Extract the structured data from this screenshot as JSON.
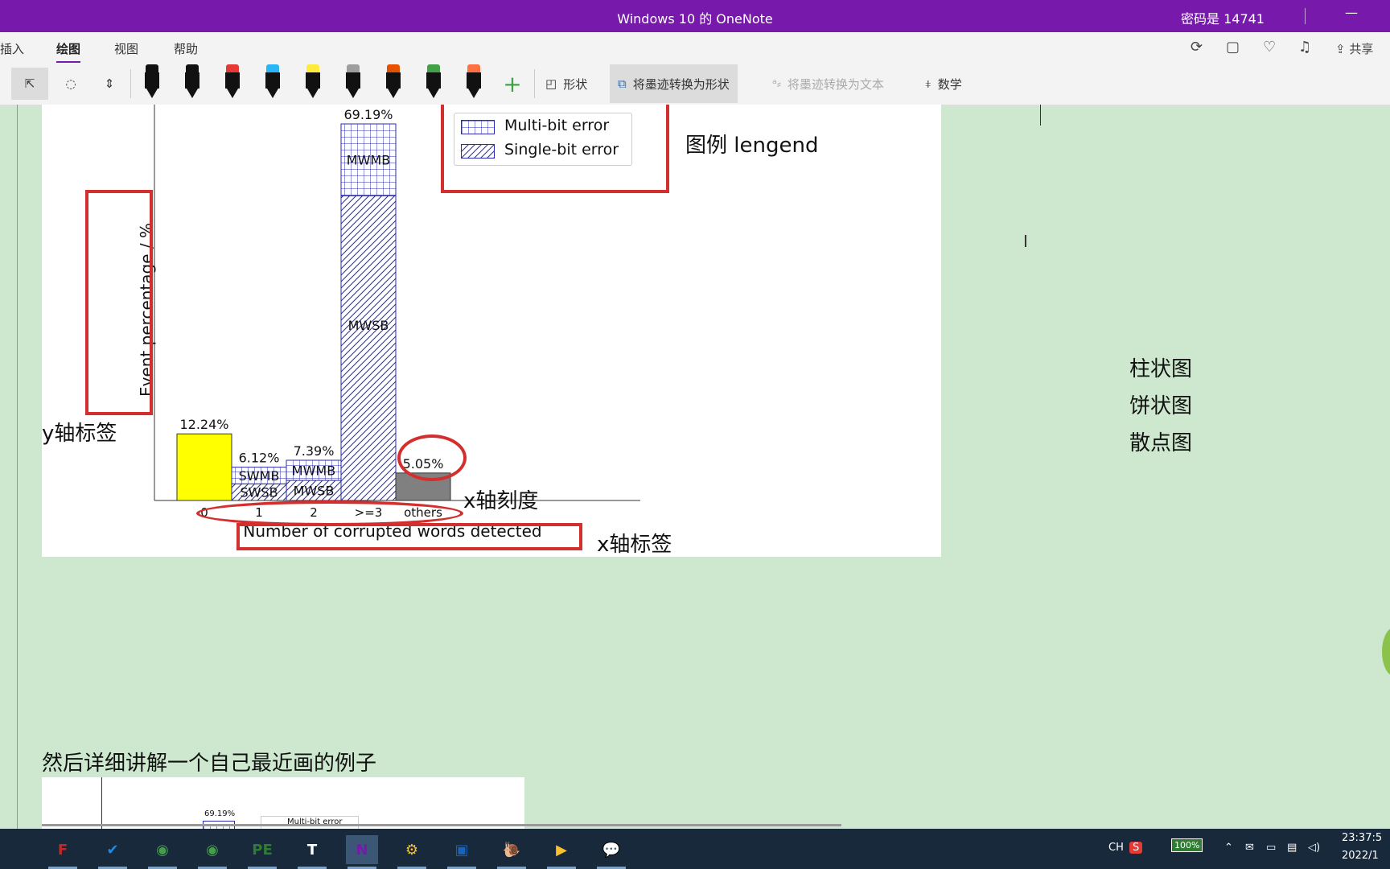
{
  "titlebar": {
    "title": "Windows 10 的 OneNote",
    "password": "密码是 14741",
    "minimize": "—"
  },
  "menu": {
    "insert": "插入",
    "draw": "绘图",
    "view": "视图",
    "help": "帮助",
    "share": "共享"
  },
  "ribbon": {
    "pen_colors": [
      "#111111",
      "#111111",
      "#e53935",
      "#29b6f6",
      "#ffeb3b",
      "#9e9e9e",
      "#e65100",
      "#43a047",
      "#ff7043"
    ],
    "shapes": "形状",
    "ink_to_shape": "将墨迹转换为形状",
    "ink_to_text": "将墨迹转换为文本",
    "math": "数学",
    "plus": "+"
  },
  "notes": {
    "legend_label": "图例 lengend",
    "y_label": "y轴标签",
    "x_ticks": "x轴刻度",
    "x_label": "x轴标签",
    "types": [
      "柱状图",
      "饼状图",
      "散点图"
    ],
    "bottom_text": "然后详细讲解一个自己最近画的例子"
  },
  "chart_data": {
    "type": "bar",
    "categories": [
      "0",
      "1",
      "2",
      ">=3",
      "others"
    ],
    "series": [
      {
        "name": "Single-bit error",
        "values": [
          12.24,
          3.06,
          3.69,
          56.0,
          0
        ]
      },
      {
        "name": "Multi-bit error",
        "values": [
          0,
          3.06,
          3.7,
          13.19,
          0
        ]
      },
      {
        "values": [
          0,
          0,
          0,
          0,
          5.05
        ]
      }
    ],
    "totals": [
      "12.24%",
      "6.12%",
      "7.39%",
      "69.19%",
      "5.05%"
    ],
    "segment_labels": [
      {
        "category": "1",
        "lower": "SWSB",
        "upper": "SWMB"
      },
      {
        "category": "2",
        "lower": "MWSB",
        "upper": "MWMB"
      },
      {
        "category": ">=3",
        "lower": "MWSB",
        "upper": "MWMB"
      }
    ],
    "ylabel": "Event percentage / %",
    "xlabel": "Number of corrupted words detected",
    "colors": {
      "single": "#ffff00",
      "hatch": "#2a2ab0",
      "others": "#808080",
      "annotation": "#d32f2f"
    }
  },
  "thumbnail": {
    "total": "69.19%",
    "legend": "Multi-bit error"
  },
  "taskbar": {
    "apps": [
      "F",
      "✔",
      "◉",
      "◉",
      "PE",
      "T",
      "N",
      "⚙",
      "▣",
      "🐌",
      "▶",
      "💬"
    ],
    "tray_lang": "CH",
    "tray_ime": "S",
    "battery": "100%",
    "time": "23:37:5",
    "date": "2022/1"
  }
}
